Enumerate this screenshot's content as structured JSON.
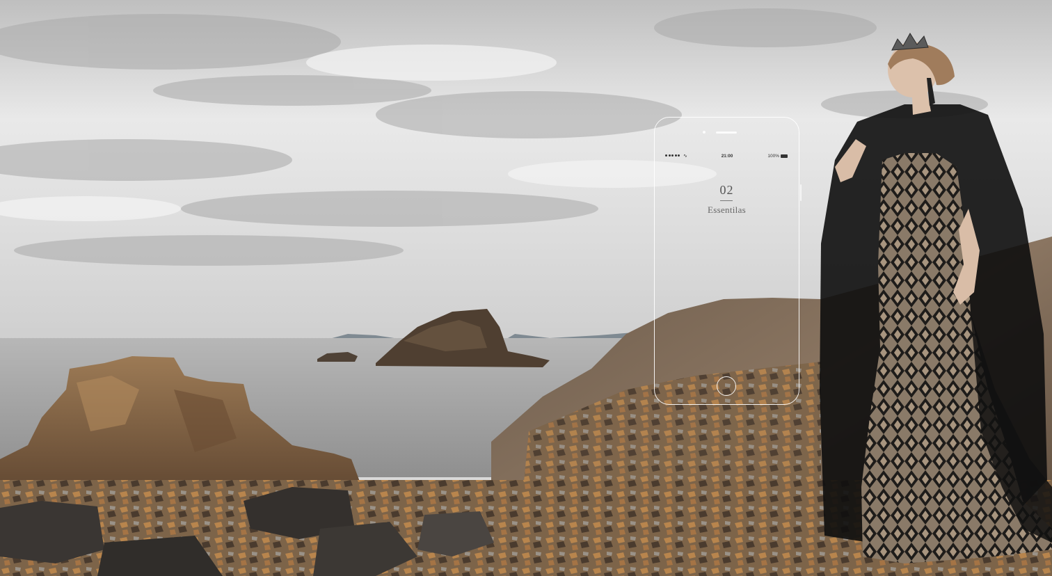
{
  "phone": {
    "status": {
      "time": "21:00",
      "battery": "100%"
    },
    "section_number": "02",
    "section_title": "Essentilas"
  },
  "colors": {
    "sky": "#e6e6e6",
    "sea": "#a9a9a9",
    "rock": "#8a6a48",
    "gown": "#1a1a1a"
  },
  "icons": {
    "signal": "signal-dots-icon",
    "wifi": "wifi-icon",
    "battery": "battery-icon",
    "home": "home-button-icon"
  }
}
